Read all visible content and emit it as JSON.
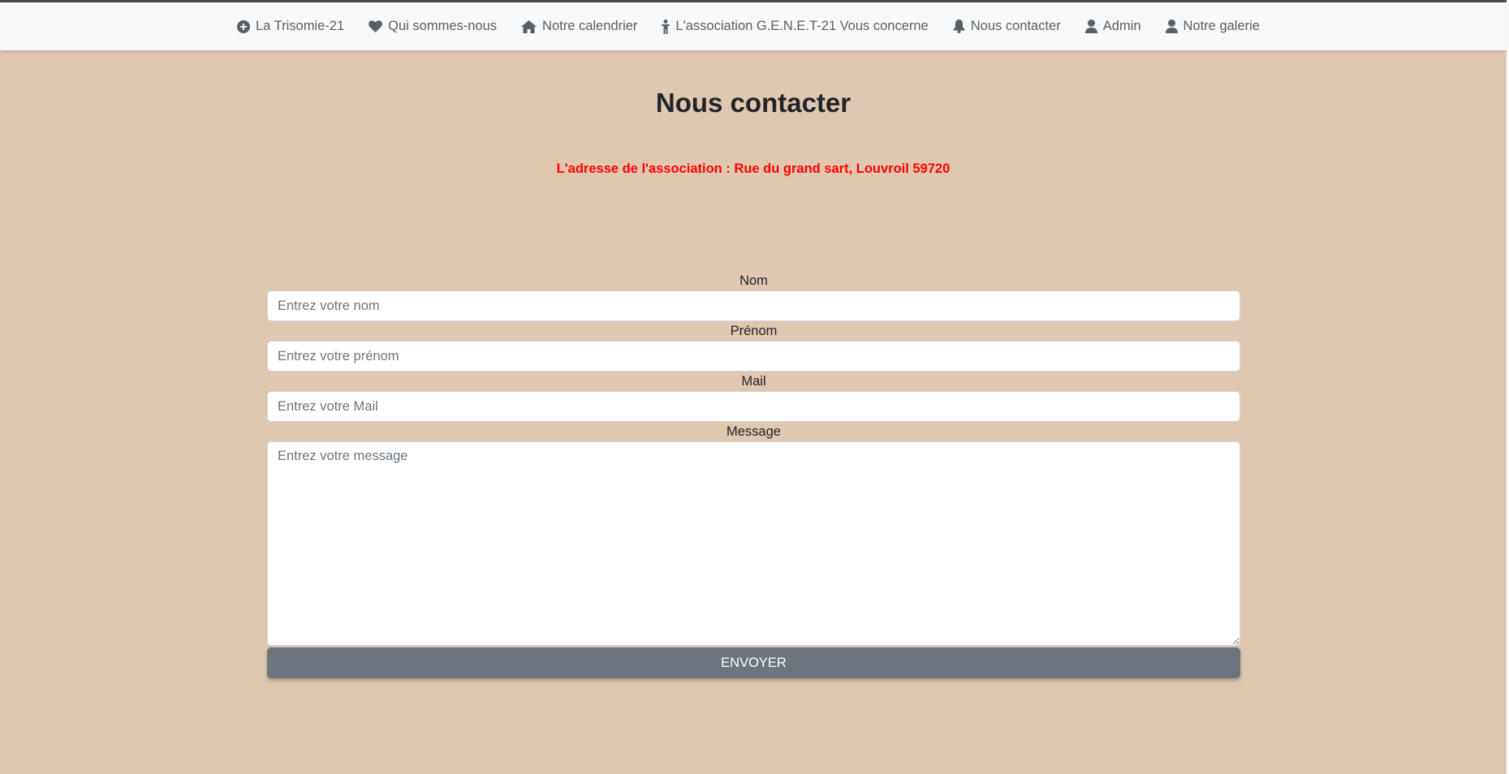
{
  "navbar": {
    "items": [
      {
        "label": "La Trisomie-21",
        "icon": "plus-circle-icon"
      },
      {
        "label": "Qui sommes-nous",
        "icon": "heart-icon"
      },
      {
        "label": "Notre calendrier",
        "icon": "home-icon"
      },
      {
        "label": "L'association G.E.N.E.T-21 Vous concerne",
        "icon": "child-icon"
      },
      {
        "label": "Nous contacter",
        "icon": "bell-icon"
      },
      {
        "label": "Admin",
        "icon": "user-icon"
      },
      {
        "label": "Notre galerie",
        "icon": "user-icon"
      }
    ]
  },
  "page": {
    "title": "Nous contacter",
    "address": "L'adresse de l'association : Rue du grand sart, Louvroil 59720"
  },
  "form": {
    "nom": {
      "label": "Nom",
      "placeholder": "Entrez votre nom",
      "value": ""
    },
    "prenom": {
      "label": "Prénom",
      "placeholder": "Entrez votre prénom",
      "value": ""
    },
    "mail": {
      "label": "Mail",
      "placeholder": "Entrez votre Mail",
      "value": ""
    },
    "message": {
      "label": "Message",
      "placeholder": "Entrez votre message",
      "value": ""
    },
    "submit_label": "Envoyer"
  },
  "colors": {
    "background": "#e0c7b0",
    "navbar_background": "#f8f9fa",
    "address_text": "#ff0000",
    "button_background": "#6c757d"
  }
}
